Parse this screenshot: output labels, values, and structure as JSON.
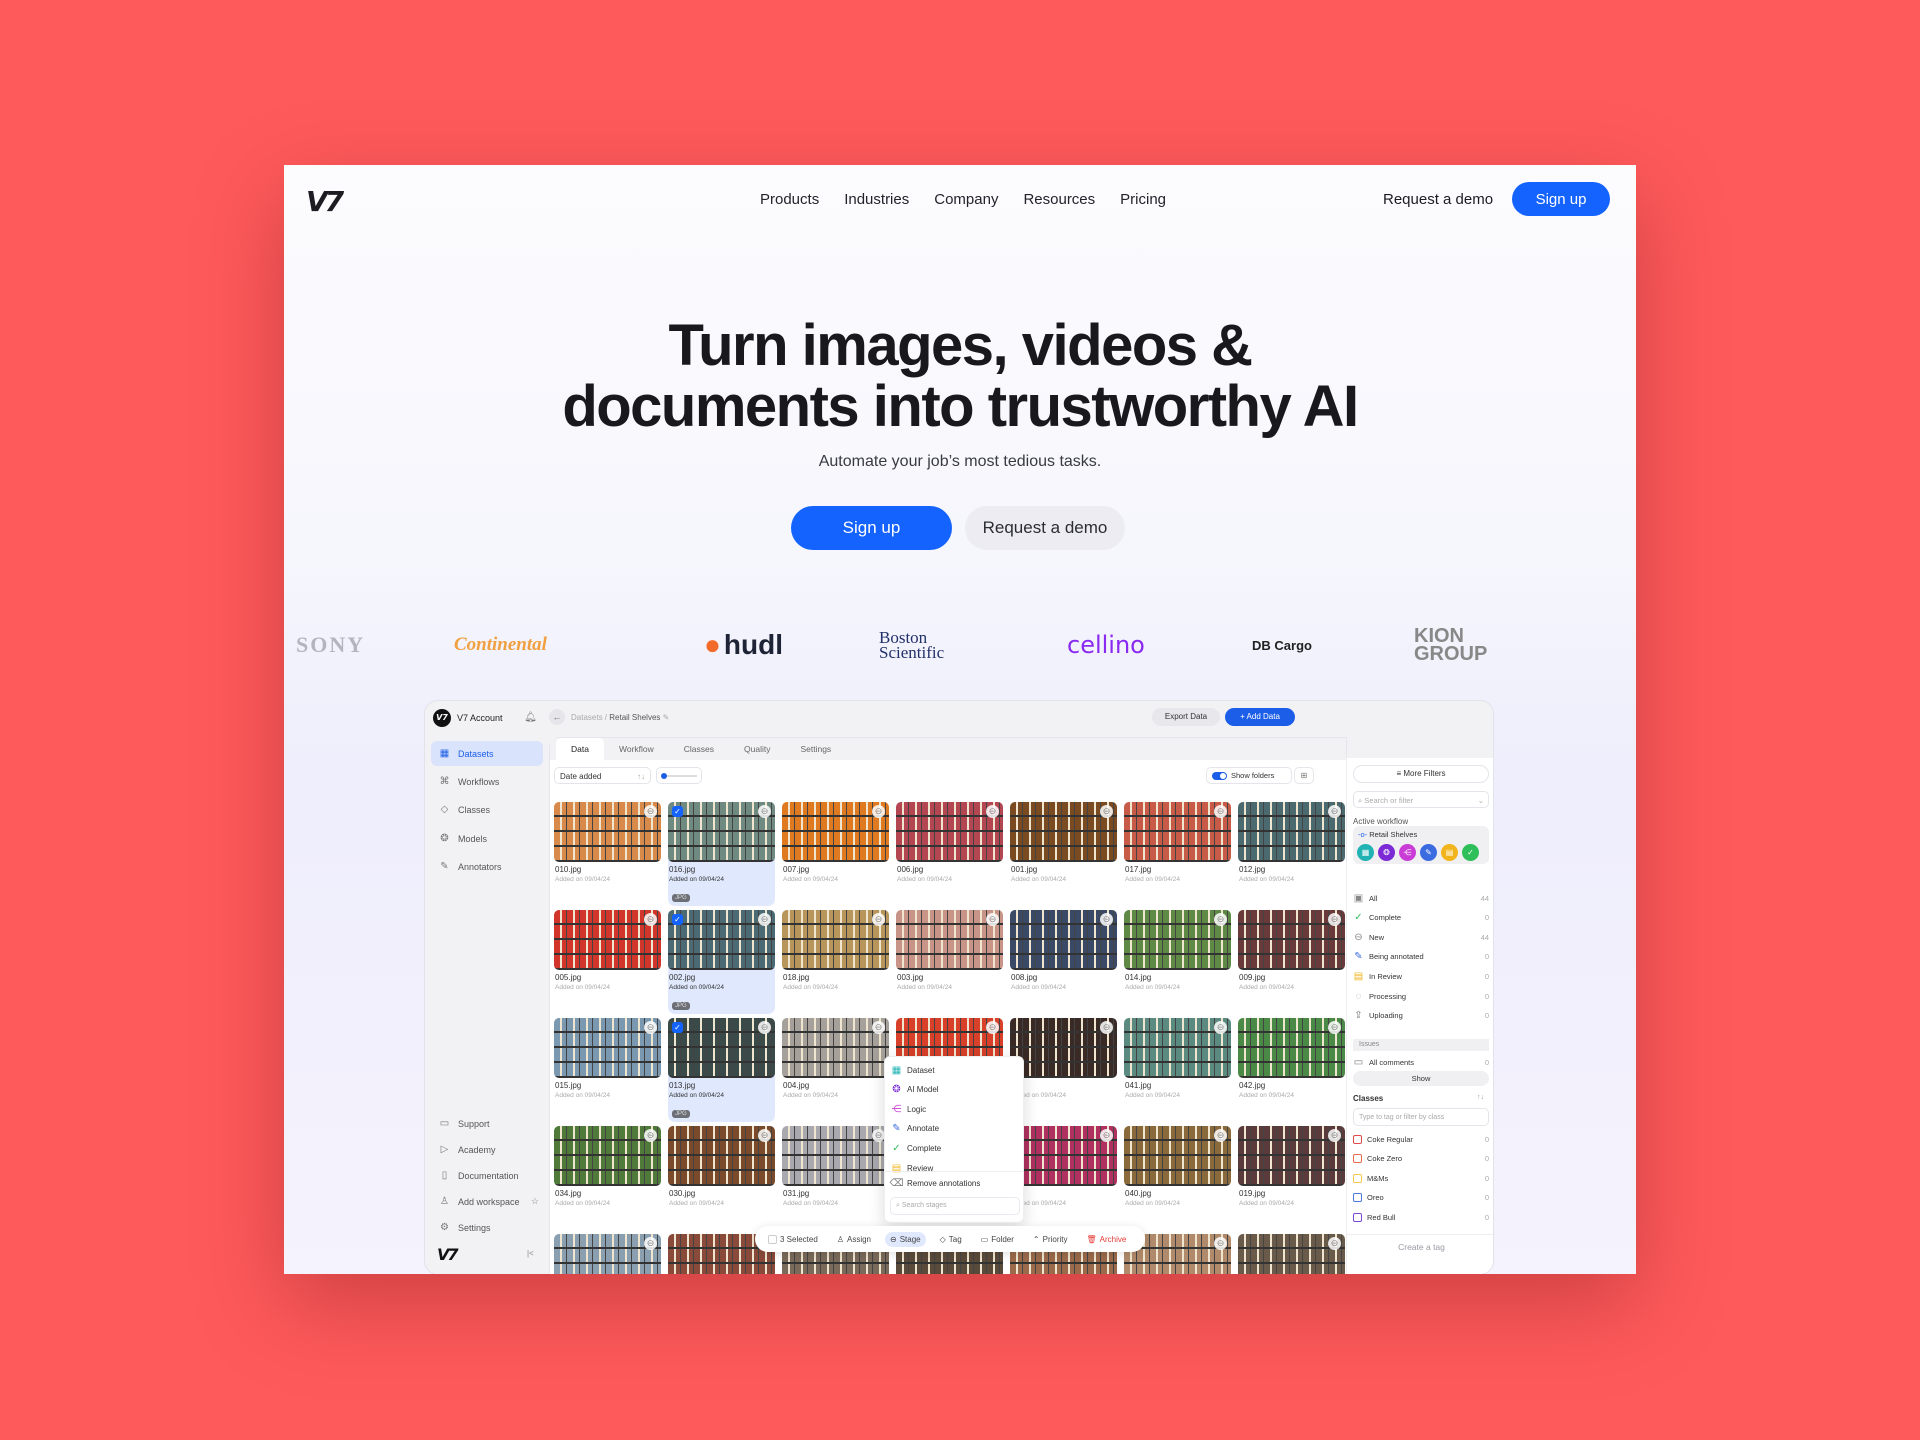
{
  "nav": {
    "logo": "V7",
    "links": [
      "Products",
      "Industries",
      "Company",
      "Resources",
      "Pricing"
    ],
    "request_demo": "Request a demo",
    "signup": "Sign up"
  },
  "hero": {
    "title_line1": "Turn images, videos &",
    "title_line2": "documents into trustworthy AI",
    "subtitle": "Automate your job’s most tedious tasks.",
    "signup": "Sign up",
    "request_demo": "Request a demo"
  },
  "logos": [
    "SONY",
    "Continental",
    "hudl",
    "Boston Scientific",
    "cellino",
    "DB Cargo",
    "KION GROUP"
  ],
  "app": {
    "account": "V7 Account",
    "breadcrumb_root": "Datasets /",
    "breadcrumb_current": "Retail Shelves",
    "export": "Export Data",
    "add": "+ Add Data",
    "sidebar": {
      "items": [
        "Datasets",
        "Workflows",
        "Classes",
        "Models",
        "Annotators"
      ],
      "bottom": [
        "Support",
        "Academy",
        "Documentation",
        "Add workspace",
        "Settings"
      ],
      "logo": "V7",
      "collapse": "|<"
    },
    "tabs": [
      "Data",
      "Workflow",
      "Classes",
      "Quality",
      "Settings"
    ],
    "sort": "Date added",
    "show_folders": "Show folders",
    "images": [
      [
        {
          "n": "010.jpg",
          "c": "#d88a4a"
        },
        {
          "n": "016.jpg",
          "c": "#6f8a80",
          "s": true
        },
        {
          "n": "007.jpg",
          "c": "#e07a20"
        },
        {
          "n": "006.jpg",
          "c": "#b34650"
        },
        {
          "n": "001.jpg",
          "c": "#7a4a20"
        },
        {
          "n": "017.jpg",
          "c": "#c85a48"
        },
        {
          "n": "012.jpg",
          "c": "#4a6a70"
        }
      ],
      [
        {
          "n": "005.jpg",
          "c": "#d2352a"
        },
        {
          "n": "002.jpg",
          "c": "#4c6a74",
          "s": true
        },
        {
          "n": "018.jpg",
          "c": "#b8955a"
        },
        {
          "n": "003.jpg",
          "c": "#c89488"
        },
        {
          "n": "008.jpg",
          "c": "#3a4a66"
        },
        {
          "n": "014.jpg",
          "c": "#5f8a46"
        },
        {
          "n": "009.jpg",
          "c": "#6a3a3a"
        }
      ],
      [
        {
          "n": "015.jpg",
          "c": "#7a98b0"
        },
        {
          "n": "013.jpg",
          "c": "#3a4a48",
          "s": true
        },
        {
          "n": "004.jpg",
          "c": "#a6a09a"
        },
        {
          "n": "",
          "c": "#d8402a"
        },
        {
          "n": "jpg",
          "c": "#3a2a26"
        },
        {
          "n": "041.jpg",
          "c": "#5a8a80"
        },
        {
          "n": "042.jpg",
          "c": "#4a8a46"
        }
      ],
      [
        {
          "n": "034.jpg",
          "c": "#4f7a3a"
        },
        {
          "n": "030.jpg",
          "c": "#7a4a2a"
        },
        {
          "n": "031.jpg",
          "c": "#a8a8ae"
        },
        {
          "n": "",
          "c": "#6a5a5a"
        },
        {
          "n": "jpg",
          "c": "#b03060"
        },
        {
          "n": "040.jpg",
          "c": "#8a6a3a"
        },
        {
          "n": "019.jpg",
          "c": "#5a3a3a"
        }
      ],
      [
        {
          "n": "",
          "c": "#8aa0b0"
        },
        {
          "n": "",
          "c": "#8a4a3a"
        },
        {
          "n": "",
          "c": "#7a6a5a"
        },
        {
          "n": "",
          "c": "#5a4a3a"
        },
        {
          "n": "",
          "c": "#9a6a4a"
        },
        {
          "n": "",
          "c": "#b08a6a"
        },
        {
          "n": "",
          "c": "#6a5a4a"
        }
      ]
    ],
    "added": "Added on 09/04/24",
    "file_badge": "JPG",
    "right": {
      "more_filters": "More Filters",
      "search_placeholder": "Search or filter",
      "active_workflow": "Active workflow",
      "workflow_name": "Retail Shelves",
      "stage_colors": [
        "#21b3b3",
        "#7b2ad6",
        "#c93cd6",
        "#3a6be0",
        "#f2b41d",
        "#2fbf5a"
      ],
      "statuses": [
        {
          "l": "All",
          "c": "44"
        },
        {
          "l": "Complete",
          "c": "0"
        },
        {
          "l": "New",
          "c": "44"
        },
        {
          "l": "Being annotated",
          "c": "0"
        },
        {
          "l": "In Review",
          "c": "0"
        },
        {
          "l": "Processing",
          "c": "0"
        },
        {
          "l": "Uploading",
          "c": "0"
        }
      ],
      "issues": "Issues",
      "comments": {
        "l": "All comments",
        "c": "0"
      },
      "show": "Show",
      "classes_title": "Classes",
      "classes_placeholder": "Type to tag or filter by class",
      "classes": [
        {
          "l": "Coke Regular",
          "c": "0",
          "col": "#e04a4a"
        },
        {
          "l": "Coke Zero",
          "c": "0",
          "col": "#ea6a4a"
        },
        {
          "l": "M&Ms",
          "c": "0",
          "col": "#f2c94c"
        },
        {
          "l": "Oreo",
          "c": "0",
          "col": "#4a7ae0"
        },
        {
          "l": "Red Bull",
          "c": "0",
          "col": "#7a4ad6"
        }
      ],
      "create_tag": "Create a tag"
    },
    "menu": {
      "items": [
        "Dataset",
        "AI Model",
        "Logic",
        "Annotate",
        "Complete",
        "Review"
      ],
      "remove": "Remove annotations",
      "search_placeholder": "Search stages"
    },
    "toolbar": {
      "selected": "3 Selected",
      "assign": "Assign",
      "stage": "Stage",
      "tag": "Tag",
      "folder": "Folder",
      "priority": "Priority",
      "archive": "Archive"
    }
  }
}
